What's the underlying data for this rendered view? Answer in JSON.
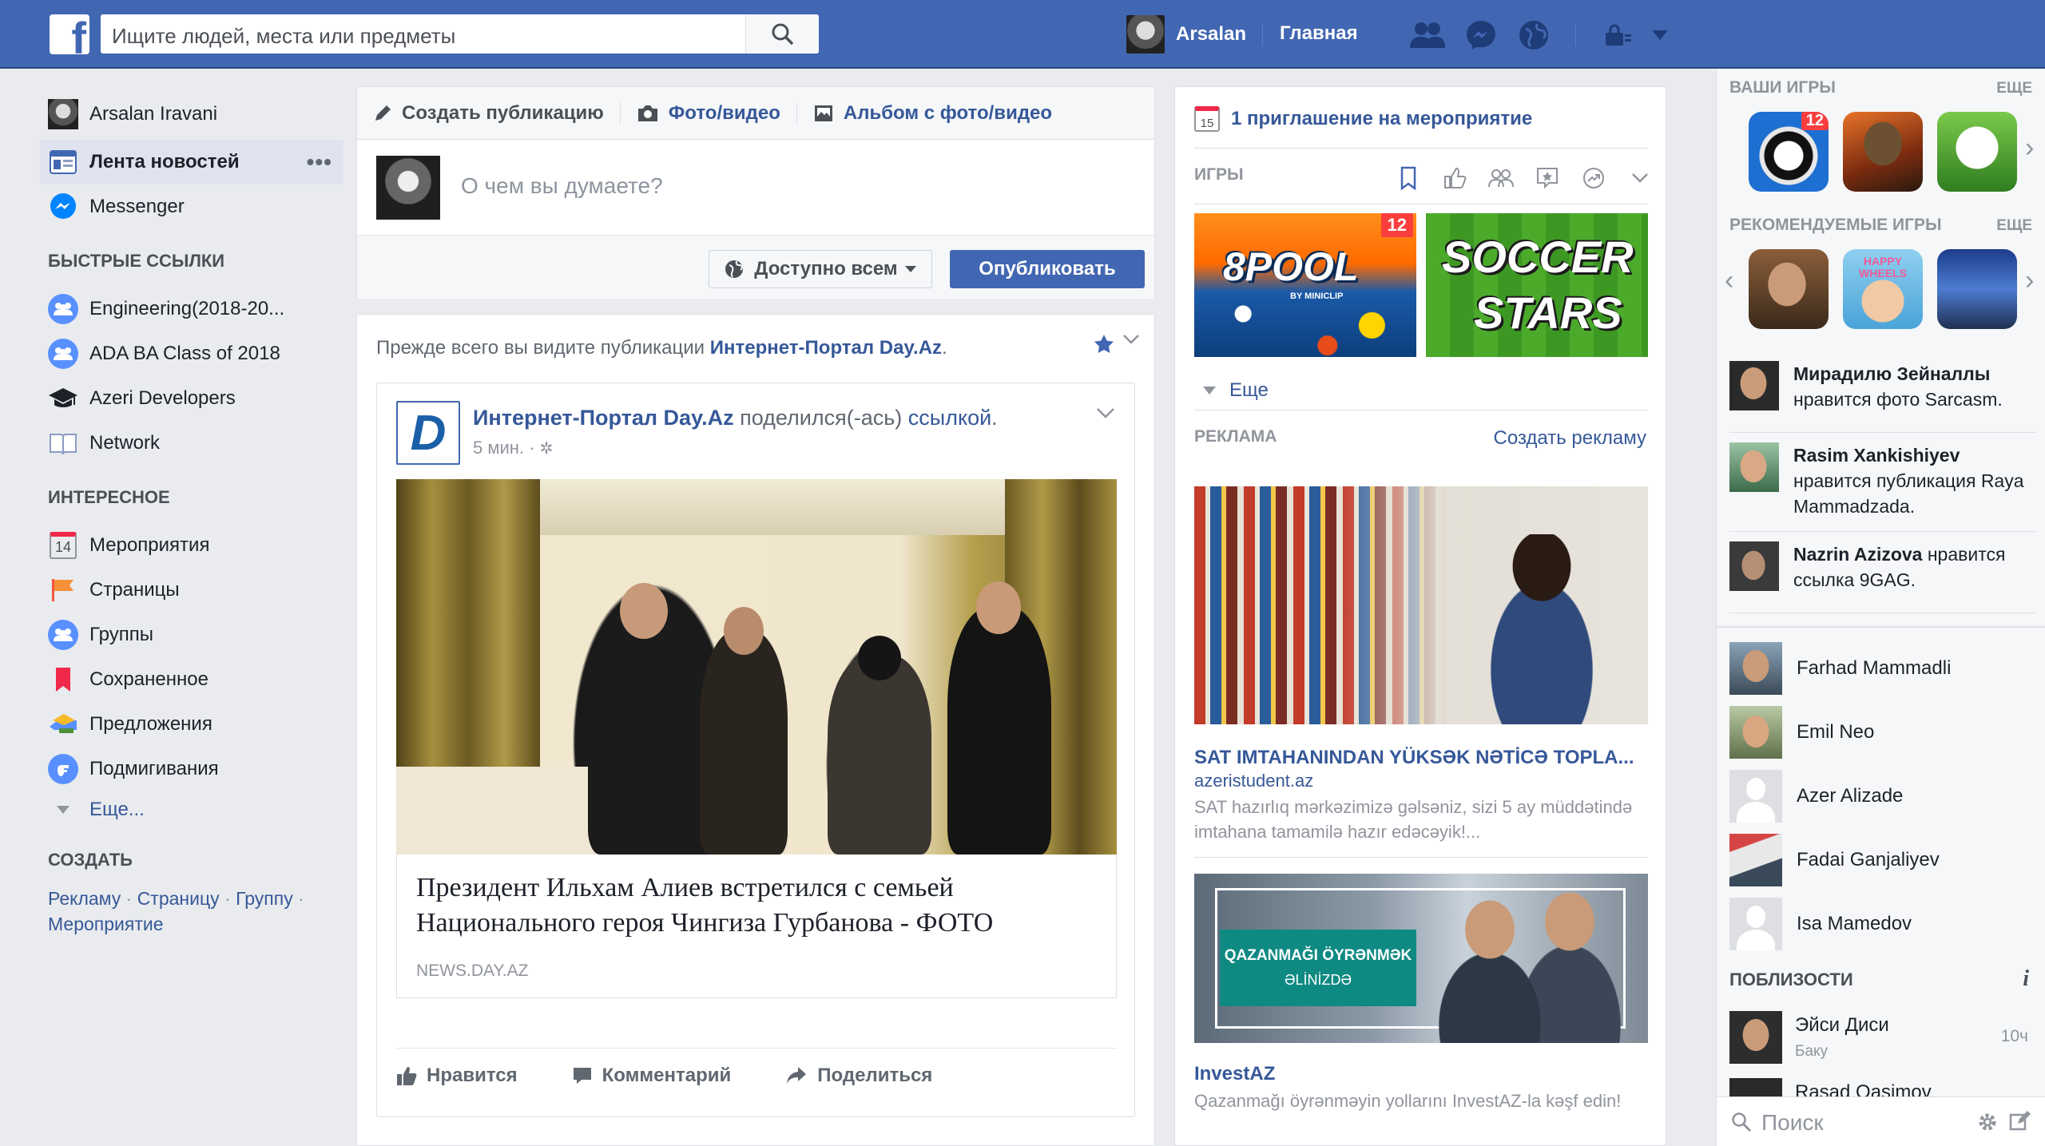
{
  "topbar": {
    "logo_letter": "f",
    "search_placeholder": "Ищите людей, места или предметы",
    "user_name": "Arsalan",
    "home_label": "Главная"
  },
  "leftnav": {
    "profile_name": "Arsalan Iravani",
    "items": [
      {
        "label": "Лента новостей",
        "icon": "news-feed-icon",
        "active": true
      },
      {
        "label": "Messenger",
        "icon": "messenger-icon"
      }
    ],
    "quick_links_header": "БЫСТРЫЕ ССЫЛКИ",
    "quick_links": [
      {
        "label": "Engineering(2018-20...",
        "icon": "group-icon"
      },
      {
        "label": "ADA BA Class of 2018",
        "icon": "group-icon"
      },
      {
        "label": "Azeri Developers",
        "icon": "graduation-cap-icon"
      },
      {
        "label": "Network",
        "icon": "book-icon"
      }
    ],
    "interesting_header": "ИНТЕРЕСНОЕ",
    "interesting": [
      {
        "label": "Мероприятия",
        "icon": "calendar-icon",
        "badge": "14"
      },
      {
        "label": "Страницы",
        "icon": "flag-icon"
      },
      {
        "label": "Группы",
        "icon": "group-icon"
      },
      {
        "label": "Сохраненное",
        "icon": "bookmark-icon"
      },
      {
        "label": "Предложения",
        "icon": "offers-icon"
      },
      {
        "label": "Подмигивания",
        "icon": "poke-icon"
      }
    ],
    "more_label": "Еще...",
    "create_header": "СОЗДАТЬ",
    "create_links": [
      "Рекламу",
      "Страницу",
      "Группу",
      "Мероприятие"
    ]
  },
  "composer": {
    "tabs": [
      "Создать публикацию",
      "Фото/видео",
      "Альбом с фото/видео"
    ],
    "placeholder": "О чем вы думаете?",
    "audience_label": "Доступно всем",
    "publish_label": "Опубликовать"
  },
  "feed": {
    "see_first_prefix": "Прежде всего вы видите публикации ",
    "see_first_page": "Интернет-Портал Day.Az",
    "see_first_suffix": ".",
    "post": {
      "logo_letter": "D",
      "author": "Интернет-Портал Day.Az",
      "action_text": " поделился(-ась) ",
      "action_link": "ссылкой",
      "action_end": ".",
      "time": "5 мин. · ",
      "link_title": "Президент Ильхам Алиев встретился с семьей Национального героя Чингиза Гурбанова - ФОТО",
      "link_domain": "NEWS.DAY.AZ",
      "actions": [
        "Нравится",
        "Комментарий",
        "Поделиться"
      ]
    }
  },
  "rightcol": {
    "event_invite": "1 приглашение на мероприятие",
    "calendar_day": "15",
    "games_header": "ИГРЫ",
    "game_tiles": [
      {
        "name": "8 Ball Pool",
        "word": "8POOL",
        "sub": "BY MINICLIP",
        "badge": "12"
      },
      {
        "name": "Soccer Stars",
        "word1": "SOCCER",
        "word2": "STARS"
      }
    ],
    "more_label": "Еще",
    "ads_header": "РЕКЛАМА",
    "create_ad_label": "Создать рекламу",
    "ads": [
      {
        "title": "SAT IMTAHANINDAN YÜKSƏK NƏTİCƏ TOPLA...",
        "domain": "azeristudent.az",
        "text": "SAT hazırlıq mərkəzimizə gəlsəniz, sizi 5 ay müddətində imtahana tamamilə hazır edəcəyik!..."
      },
      {
        "banner_line1": "QAZANMAĞI ÖYRƏNMƏK",
        "banner_line2": "ƏLİNİZDƏ",
        "title": "InvestAZ",
        "text": "Qazanmağı öyrənməyin yollarını InvestAZ-la kəşf edin!"
      }
    ]
  },
  "sidebar": {
    "your_games_header": "ВАШИ ИГРЫ",
    "more_label": "ЕЩЕ",
    "your_games_badge": "12",
    "recommended_header": "РЕКОМЕНДУЕМЫЕ ИГРЫ",
    "happy_wheels_label": "HAPPY WHEELS",
    "ticker": [
      {
        "name": "Мирадилю Зейналлы",
        "text": " нравится фото Sarcasm."
      },
      {
        "name": "Rasim Xankishiyev",
        "text": " нравится публикация Raya Mammadzada."
      },
      {
        "name": "Nazrin Azizova",
        "text": " нравится ссылка 9GAG."
      }
    ],
    "contacts": [
      "Farhad Mammadli",
      "Emil Neo",
      "Azer Alizade",
      "Fadai Ganjaliyev",
      "Isa Mamedov"
    ],
    "nearby_header": "ПОБЛИЗОСТИ",
    "nearby_info_icon": "i",
    "nearby": [
      {
        "name": "Эйси Диси",
        "city": "Баку",
        "distance": "10ч"
      },
      {
        "name": "Rasad Qasimov"
      }
    ],
    "chat_search_placeholder": "Поиск"
  }
}
